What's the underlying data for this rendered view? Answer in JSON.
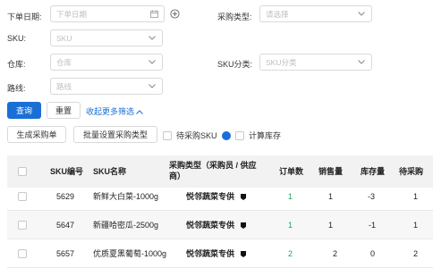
{
  "filters": {
    "order_date": {
      "label": "下单日期:",
      "placeholder": "下单日期"
    },
    "purchase_type": {
      "label": "采购类型:",
      "placeholder": "请选择"
    },
    "sku": {
      "label": "SKU:",
      "placeholder": "SKU"
    },
    "warehouse": {
      "label": "仓库:",
      "placeholder": "仓库"
    },
    "sku_category": {
      "label": "SKU分类:",
      "placeholder": "SKU分类"
    },
    "route": {
      "label": "路线:",
      "placeholder": "路线"
    }
  },
  "actions": {
    "query": "查询",
    "reset": "重置",
    "collapse": "收起更多筛选",
    "generate_po": "生成采购单",
    "batch_set_type": "批量设置采购类型",
    "pending_sku": "待采购SKU",
    "calc_stock": "计算库存"
  },
  "table": {
    "headers": {
      "sku_no": "SKU编号",
      "sku_name": "SKU名称",
      "purchase_type": "采购类型（采购员 / 供应商）",
      "order_count": "订单数",
      "sales": "销售量",
      "stock": "库存量",
      "pending": "待采购"
    },
    "rows": [
      {
        "sku_no": "5629",
        "sku_name": "新鲜大白菜-1000g",
        "supplier": "悦邻蔬菜专供",
        "order_count": "1",
        "sales": "1",
        "stock": "-3",
        "pending": "1"
      },
      {
        "sku_no": "5647",
        "sku_name": "新疆哈密瓜-2500g",
        "supplier": "悦邻蔬菜专供",
        "order_count": "1",
        "sales": "1",
        "stock": "-1",
        "pending": "1"
      },
      {
        "sku_no": "5657",
        "sku_name": "优质夏黑葡萄-1000g",
        "supplier": "悦邻蔬菜专供",
        "order_count": "2",
        "sales": "2",
        "stock": "0",
        "pending": "2"
      }
    ]
  },
  "colors": {
    "primary": "#1a6fd7",
    "count_green": "#1aa55b"
  }
}
